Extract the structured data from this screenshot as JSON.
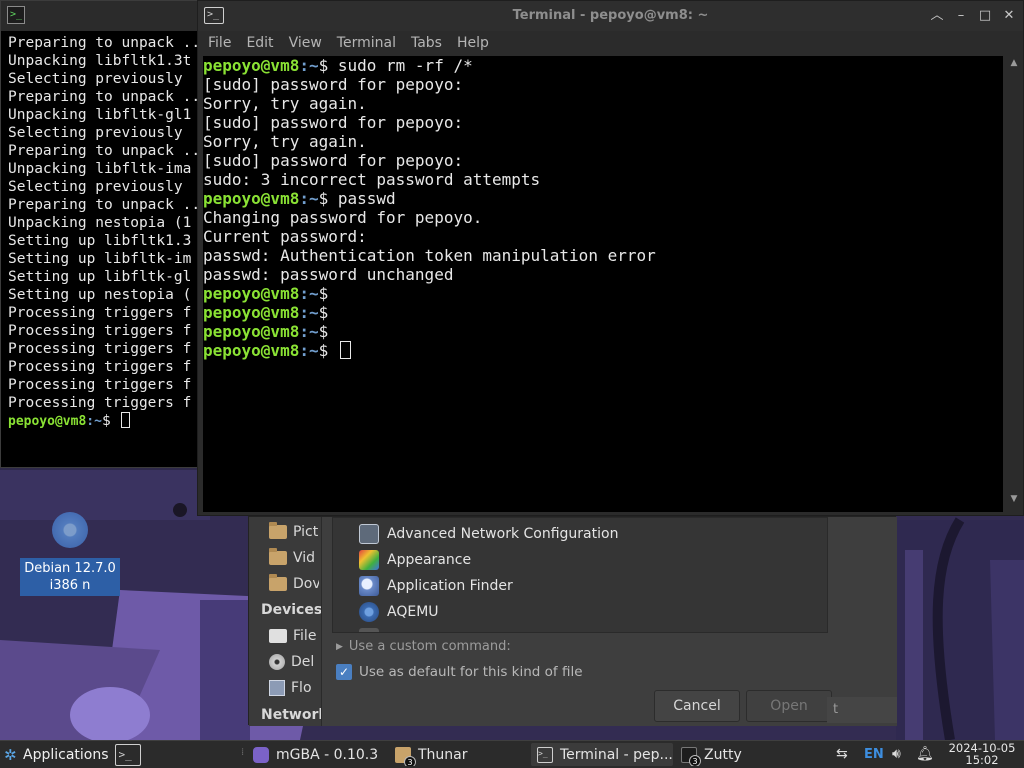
{
  "desktop": {
    "icon_label_line1": "Debian 12.7.0",
    "icon_label_line2": "i386 n"
  },
  "left_terminal": {
    "lines": [
      "Preparing to unpack ...",
      "Unpacking libfltk1.3t",
      "Selecting previously ",
      "Preparing to unpack ...",
      "Unpacking libfltk-gl1",
      "Selecting previously ",
      "Preparing to unpack ...",
      "Unpacking libfltk-ima",
      "Selecting previously ",
      "Preparing to unpack ...",
      "Unpacking nestopia (1",
      "Setting up libfltk1.3",
      "Setting up libfltk-im",
      "Setting up libfltk-gl",
      "Setting up nestopia (",
      "Processing triggers f",
      "Processing triggers f",
      "Processing triggers f",
      "Processing triggers f",
      "Processing triggers f",
      "Processing triggers f"
    ],
    "prompt_user": "pepoyo@vm8",
    "prompt_path": ":~",
    "prompt_symbol": "$ "
  },
  "terminal": {
    "title": "Terminal - pepoyo@vm8: ~",
    "menu": [
      "File",
      "Edit",
      "View",
      "Terminal",
      "Tabs",
      "Help"
    ],
    "prompt_user": "pepoyo@vm8",
    "prompt_path": ":~",
    "lines": [
      {
        "type": "prompt",
        "cmd": "$ sudo rm -rf /*"
      },
      {
        "type": "out",
        "text": "[sudo] password for pepoyo:"
      },
      {
        "type": "out",
        "text": "Sorry, try again."
      },
      {
        "type": "out",
        "text": "[sudo] password for pepoyo:"
      },
      {
        "type": "out",
        "text": "Sorry, try again."
      },
      {
        "type": "out",
        "text": "[sudo] password for pepoyo:"
      },
      {
        "type": "out",
        "text": "sudo: 3 incorrect password attempts"
      },
      {
        "type": "prompt",
        "cmd": "$ passwd"
      },
      {
        "type": "out",
        "text": "Changing password for pepoyo."
      },
      {
        "type": "out",
        "text": "Current password:"
      },
      {
        "type": "out",
        "text": "passwd: Authentication token manipulation error"
      },
      {
        "type": "out",
        "text": "passwd: password unchanged"
      },
      {
        "type": "prompt",
        "cmd": "$"
      },
      {
        "type": "prompt",
        "cmd": "$"
      },
      {
        "type": "prompt",
        "cmd": "$"
      },
      {
        "type": "prompt",
        "cmd": "$ ",
        "cursor": true
      }
    ]
  },
  "open_with_dialog": {
    "sidebar": {
      "places": [
        "Pict",
        "Vid",
        "Dov"
      ],
      "devices_heading": "Devices",
      "devices": [
        "File",
        "Del",
        "Flo"
      ],
      "network_heading": "Networl"
    },
    "apps": [
      {
        "name": "Advanced Network Configuration",
        "icon": "network-config-icon"
      },
      {
        "name": "Appearance",
        "icon": "appearance-icon"
      },
      {
        "name": "Application Finder",
        "icon": "app-finder-icon"
      },
      {
        "name": "AQEMU",
        "icon": "aqemu-icon"
      }
    ],
    "custom_command": "Use a custom command:",
    "default_checkbox": "Use as default for this kind of file",
    "cancel": "Cancel",
    "open": "Open",
    "peek_text": "t"
  },
  "taskbar": {
    "applications": "Applications",
    "tasks": [
      {
        "label": "mGBA - 0.10.3",
        "icon": "mgba-icon"
      },
      {
        "label": "Thunar",
        "icon": "folder-icon",
        "badge": "3"
      },
      {
        "label": "Terminal - pep...",
        "icon": "terminal-icon"
      },
      {
        "label": "Zutty",
        "icon": "zutty-icon",
        "badge": "3"
      }
    ],
    "keyboard_layout": "EN",
    "date": "2024-10-05",
    "time": "15:02"
  },
  "colors": {
    "prompt_user": "#8ae234",
    "prompt_path": "#729fcf",
    "checkbox": "#4a7fc1"
  }
}
